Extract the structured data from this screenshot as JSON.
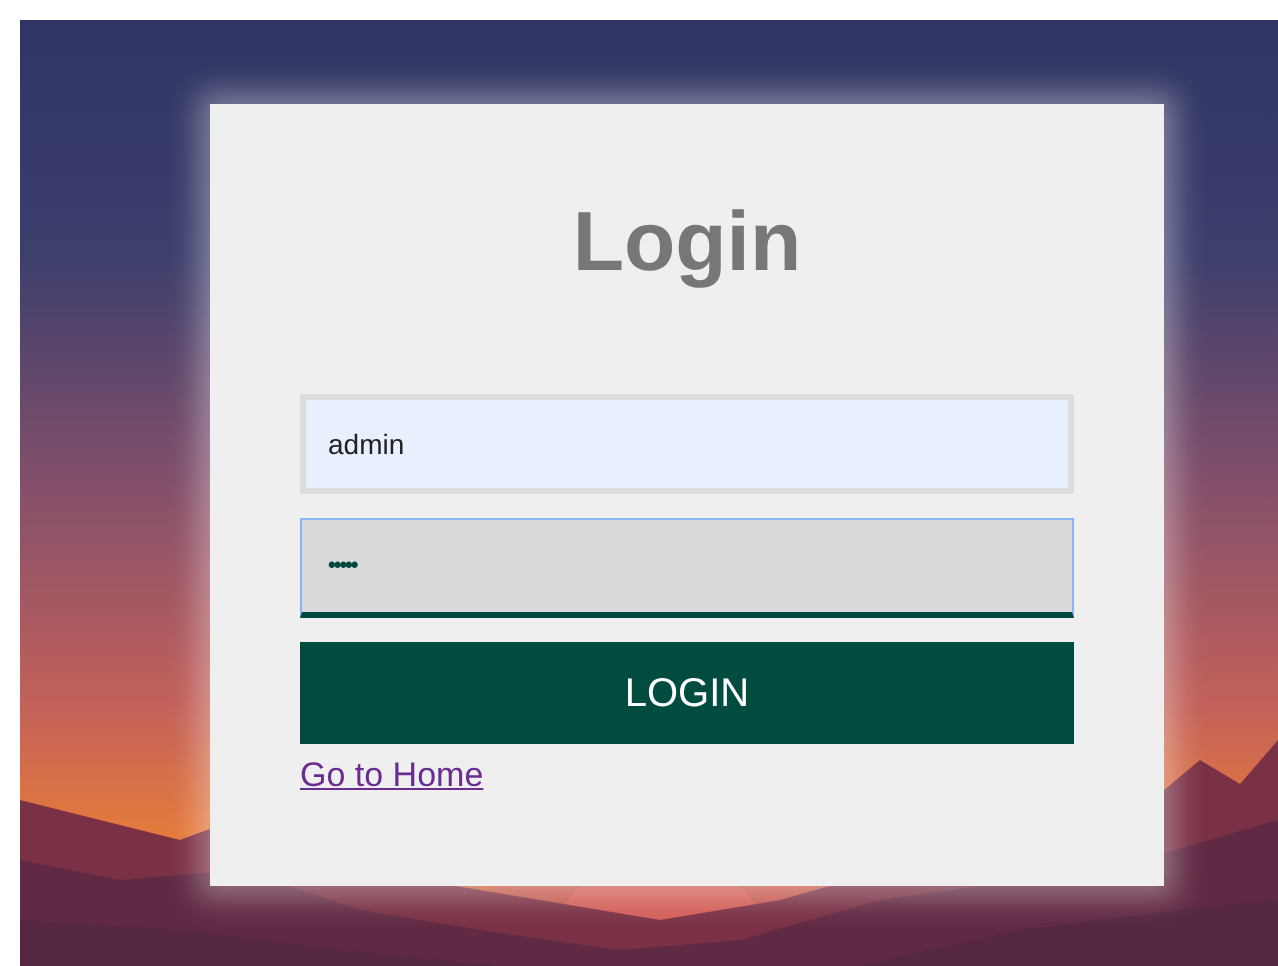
{
  "title": "Login",
  "fields": [
    {
      "kind": "text",
      "value": "admin",
      "focused": false
    },
    {
      "kind": "password",
      "value": "•••••",
      "focused": true
    }
  ],
  "button": "LOGIN",
  "link": {
    "label": "Go to Home",
    "visited": true
  }
}
